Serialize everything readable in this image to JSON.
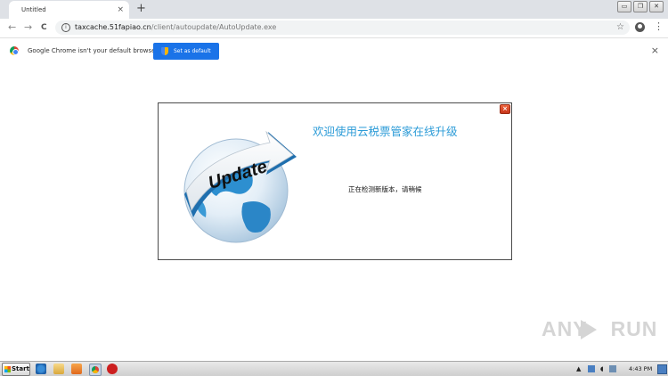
{
  "browser": {
    "tab_title": "Untitled",
    "tab_close": "×",
    "new_tab": "+",
    "window_buttons": [
      "▭",
      "❐",
      "✕"
    ],
    "back": "←",
    "forward": "→",
    "reload": "C",
    "url_host": "taxcache.51fapiao.cn",
    "url_path": "/client/autoupdate/AutoUpdate.exe",
    "bookmark_star": "☆",
    "menu": "⋮"
  },
  "infobar": {
    "message": "Google Chrome isn't your default browser",
    "button_label": "Set as default",
    "close": "×"
  },
  "dialog": {
    "title": "欢迎使用云税票管家在线升级",
    "status": "正在检测新版本，请稍候",
    "close": "×",
    "graphic_text": "Update"
  },
  "watermark": {
    "left": "ANY",
    "right": "RUN"
  },
  "taskbar": {
    "start_label": "Start",
    "clock": "4:43 PM",
    "tray_icons": [
      "flag-icon",
      "volume-icon",
      "network-icon"
    ]
  },
  "colors": {
    "accent_blue": "#1a73e8",
    "dialog_title": "#2b9bd7",
    "close_red": "#d9441f"
  }
}
